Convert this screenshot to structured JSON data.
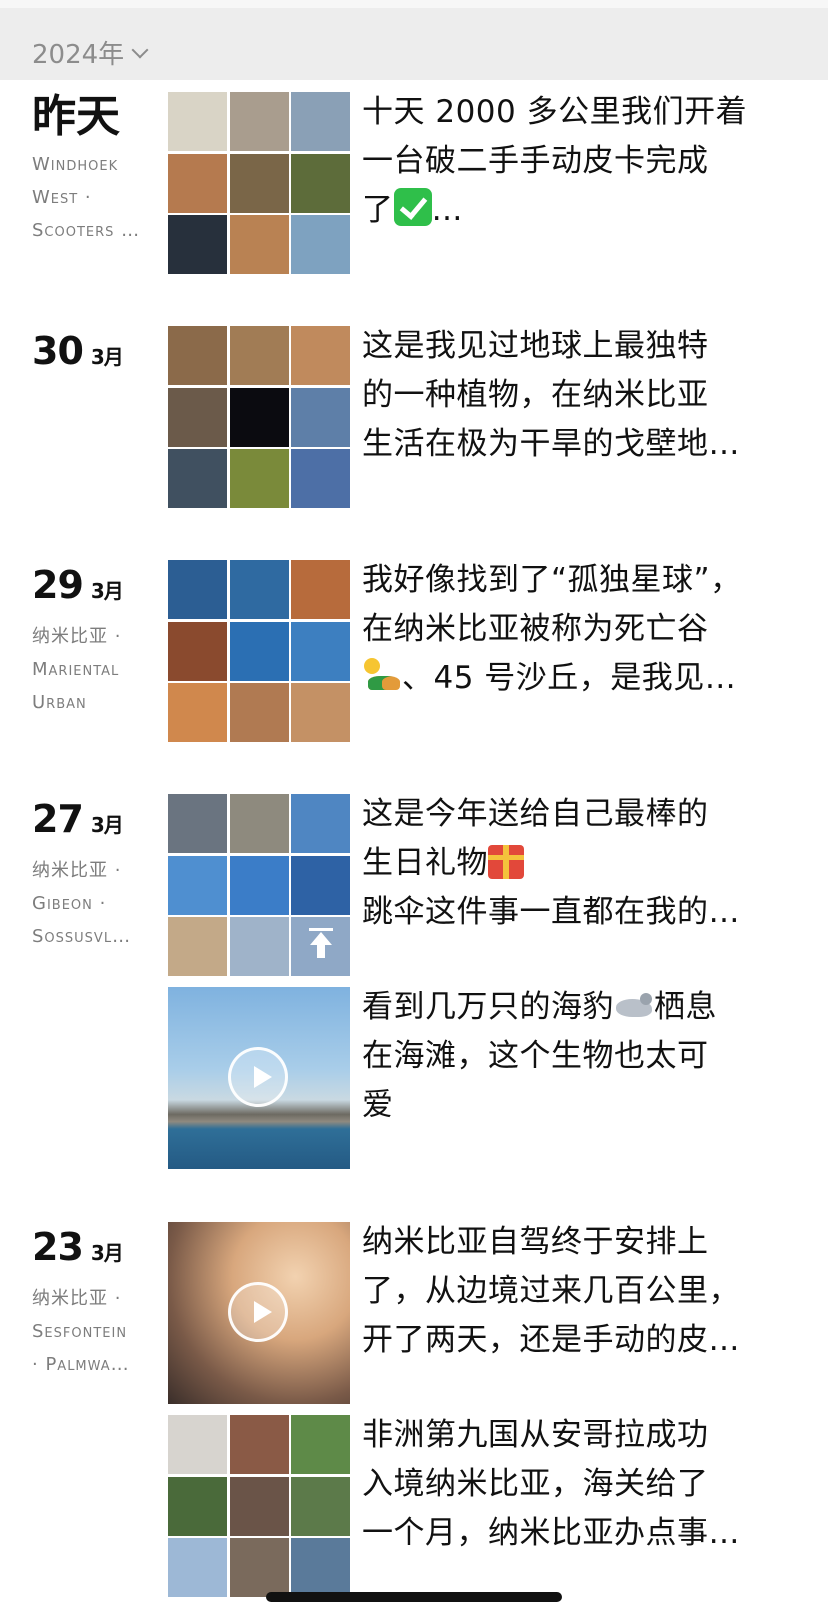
{
  "header": {
    "year_label": "2024年"
  },
  "entries": [
    {
      "day": "昨天",
      "month": "",
      "location": [
        "Windhoek",
        "West ·",
        "Scooters …"
      ],
      "posts": [
        {
          "type": "grid",
          "text_lines": [
            "十天 2000 多公里我们开着",
            "一台破二手手动皮卡完成",
            "了"
          ],
          "text_tail": "…",
          "emoji": "check-mark-icon",
          "tiles": [
            "#d9d4c6",
            "#a99d8e",
            "#8aa0b6",
            "#b57a4f",
            "#7a6648",
            "#5d6c3a",
            "#27303c",
            "#b98253",
            "#7ea2c0"
          ]
        }
      ]
    },
    {
      "day": "30",
      "month": "3月",
      "location": [],
      "posts": [
        {
          "type": "grid",
          "text_lines": [
            "这是我见过地球上最独特",
            "的一种植物，在纳米比亚",
            "生活在极为干旱的戈壁地…"
          ],
          "tiles": [
            "#8b6a4a",
            "#a17c55",
            "#c08a5d",
            "#6b5a4a",
            "#0b0b10",
            "#5e7fa8",
            "#405060",
            "#7a8a3a",
            "#4d6fa6"
          ]
        }
      ]
    },
    {
      "day": "29",
      "month": "3月",
      "location": [
        "纳米比亚 ·",
        "Mariental",
        "Urban"
      ],
      "posts": [
        {
          "type": "grid",
          "text_lines": [
            "我好像找到了“孤独星球”，",
            "在纳米比亚被称为死亡谷",
            "、45 号沙丘，是我见…"
          ],
          "emoji": "desert-icon",
          "tiles": [
            "#2c5e93",
            "#2f6aa1",
            "#b76b3c",
            "#8a4a2e",
            "#2b6fb3",
            "#3d7fc0",
            "#d0884d",
            "#b07a52",
            "#c49165"
          ]
        }
      ]
    },
    {
      "day": "27",
      "month": "3月",
      "location": [
        "纳米比亚 ·",
        "Gibeon ·",
        "Sossusvl…"
      ],
      "posts": [
        {
          "type": "grid",
          "text_lines": [
            "这是今年送给自己最棒的",
            "生日礼物",
            "跳伞这件事一直都在我的…"
          ],
          "emoji": "gift-icon",
          "tiles": [
            "#6a7480",
            "#8e8a7e",
            "#4f86c2",
            "#4f8fd0",
            "#3b7dc8",
            "#2e62a5",
            "#c3a988",
            "#9fb3c9",
            "#8fa8c6"
          ]
        },
        {
          "type": "video",
          "text_lines": [
            "看到几万只的海豹",
            "栖息",
            "在海滩，这个生物也太可",
            "爱"
          ],
          "emoji": "seal-icon"
        }
      ]
    },
    {
      "day": "23",
      "month": "3月",
      "location": [
        "纳米比亚 ·",
        "Sesfontein",
        "· Palmwa…"
      ],
      "posts": [
        {
          "type": "video",
          "text_lines": [
            "纳米比亚自驾终于安排上",
            "了，从边境过来几百公里，",
            "开了两天，还是手动的皮…"
          ]
        },
        {
          "type": "grid",
          "text_lines": [
            "非洲第九国从安哥拉成功",
            "入境纳米比亚，海关给了",
            "一个月，纳米比亚办点事…"
          ],
          "tiles": [
            "#d7d4cf",
            "#8a5a46",
            "#5e8a48",
            "#4a6a3a",
            "#6a5448",
            "#5c7a4a",
            "#9db8d6",
            "#7a6a5c",
            "#5a7a9a"
          ]
        }
      ]
    }
  ]
}
